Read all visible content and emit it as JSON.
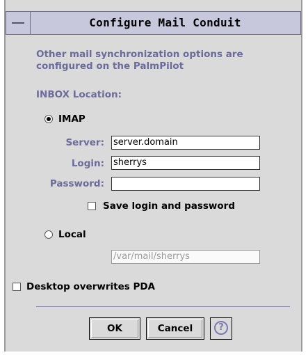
{
  "dialog": {
    "title": "Configure Mail Conduit",
    "info_text": "Other mail synchronization options are configured on the PalmPilot",
    "inbox_location_label": "INBOX Location:",
    "imap_label": "IMAP",
    "imap_selected": true,
    "server_label": "Server:",
    "server_value": "server.domain",
    "login_label": "Login:",
    "login_value": "sherrys",
    "password_label": "Password:",
    "password_value": "",
    "save_login_label": "Save login and password",
    "save_login_checked": false,
    "local_label": "Local",
    "local_selected": false,
    "local_path": "/var/mail/sherrys",
    "desktop_overwrites_label": "Desktop overwrites PDA",
    "desktop_overwrites_checked": false,
    "ok_label": "OK",
    "cancel_label": "Cancel",
    "help_icon": "question-mark-icon",
    "help_glyph": "?"
  },
  "colors": {
    "accent_label": "#6b6b9c",
    "titlebar_bg": "#c8c8dc",
    "dialog_bg": "#dadada"
  }
}
